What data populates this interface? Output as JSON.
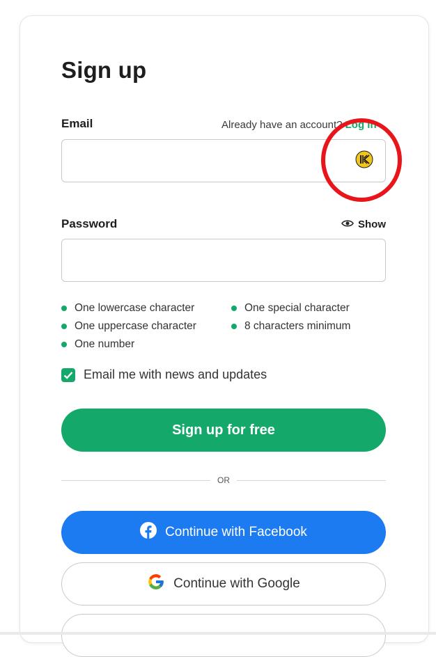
{
  "title": "Sign up",
  "email": {
    "label": "Email",
    "value": "",
    "login_prompt": "Already have an account?",
    "login_link": "Log in"
  },
  "password": {
    "label": "Password",
    "value": "",
    "show_label": "Show"
  },
  "rules": {
    "left": [
      "One lowercase character",
      "One uppercase character",
      "One number"
    ],
    "right": [
      "One special character",
      "8 characters minimum"
    ]
  },
  "newsletter": {
    "label": "Email me with news and updates",
    "checked": true
  },
  "signup_button": "Sign up for free",
  "divider": "OR",
  "facebook_button": "Continue with Facebook",
  "google_button": "Continue with Google",
  "colors": {
    "brand_green": "#15a86b",
    "facebook_blue": "#1c7bf0",
    "highlight_red": "#e8161b"
  }
}
